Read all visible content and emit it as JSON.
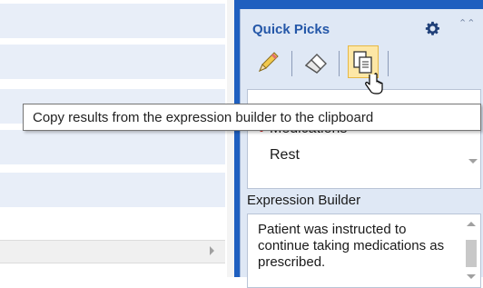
{
  "quick_picks": {
    "title": "Quick Picks",
    "collapse_glyph": "⌃⌃",
    "toolbar": {
      "buttons": [
        {
          "name": "pencil-button",
          "icon": "pencil-icon"
        },
        {
          "name": "eraser-button",
          "icon": "eraser-icon"
        },
        {
          "name": "copy-button",
          "icon": "copy-icon",
          "active": true
        }
      ]
    },
    "list": {
      "items": [
        "Medications",
        "Rest"
      ]
    },
    "expression_builder": {
      "label": "Expression Builder",
      "text": "Patient was instructed to continue taking medications as prescribed."
    }
  },
  "tooltip": {
    "text": "Copy results from the expression builder to the clipboard"
  },
  "colors": {
    "panel_frame": "#1f5fbf",
    "panel_bg": "#dfe8f5",
    "title": "#2457a8",
    "active_button": "#fde7a6",
    "row_highlight": "#e8eef8"
  }
}
